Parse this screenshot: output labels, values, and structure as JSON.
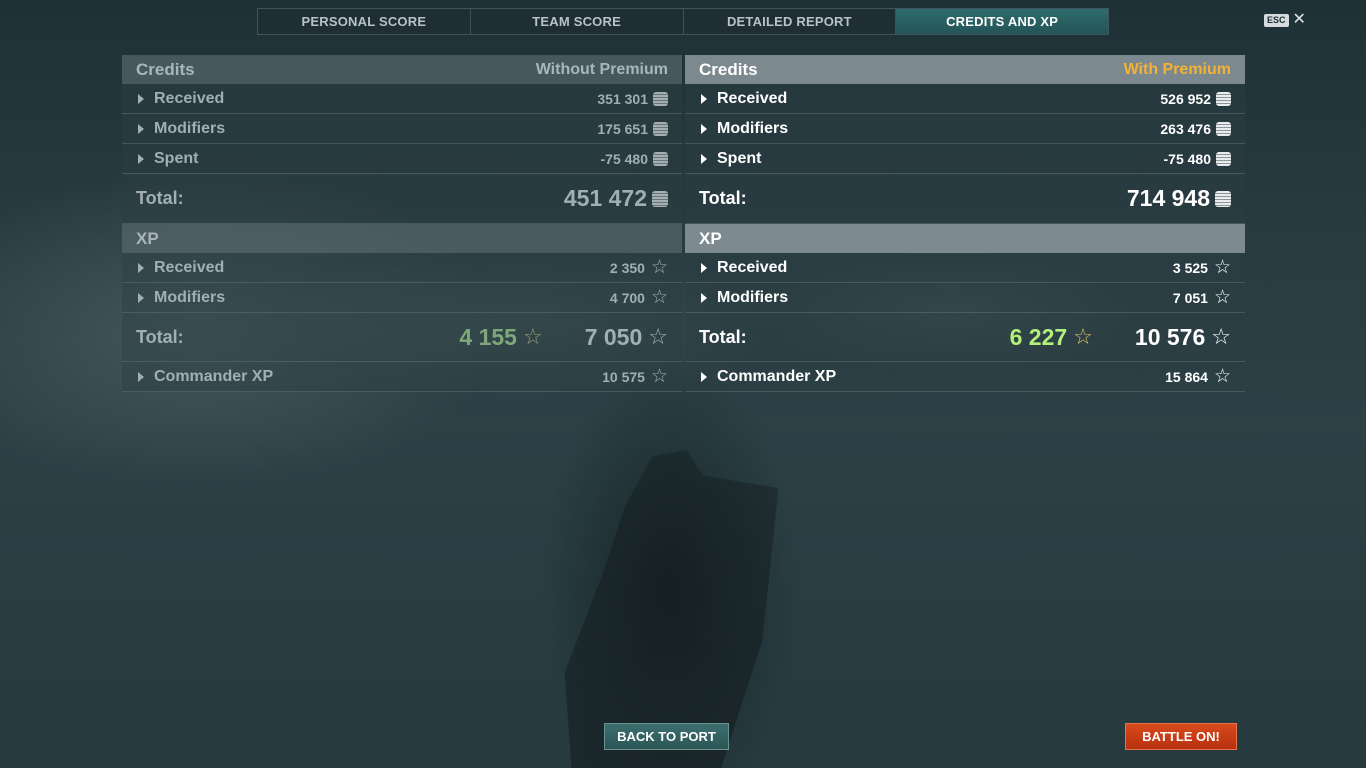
{
  "tabs": [
    {
      "label": "PERSONAL SCORE",
      "active": false
    },
    {
      "label": "TEAM SCORE",
      "active": false
    },
    {
      "label": "DETAILED REPORT",
      "active": false
    },
    {
      "label": "CREDITS AND XP",
      "active": true
    }
  ],
  "esc": {
    "key": "ESC",
    "close_icon": "close-icon"
  },
  "without_premium": {
    "credits_title": "Credits",
    "tag": "Without Premium",
    "credits_rows": [
      {
        "label": "Received",
        "value": "351 301"
      },
      {
        "label": "Modifiers",
        "value": "175 651"
      },
      {
        "label": "Spent",
        "value": "-75 480"
      }
    ],
    "credits_total_label": "Total:",
    "credits_total": "451 472",
    "xp_title": "XP",
    "xp_rows": [
      {
        "label": "Received",
        "value": "2 350"
      },
      {
        "label": "Modifiers",
        "value": "4 700"
      }
    ],
    "xp_total_label": "Total:",
    "xp_total_free": "4 155",
    "xp_total": "7 050",
    "commander_label": "Commander XP",
    "commander_value": "10 575"
  },
  "with_premium": {
    "credits_title": "Credits",
    "tag": "With Premium",
    "credits_rows": [
      {
        "label": "Received",
        "value": "526 952"
      },
      {
        "label": "Modifiers",
        "value": "263 476"
      },
      {
        "label": "Spent",
        "value": "-75 480"
      }
    ],
    "credits_total_label": "Total:",
    "credits_total": "714 948",
    "xp_title": "XP",
    "xp_rows": [
      {
        "label": "Received",
        "value": "3 525"
      },
      {
        "label": "Modifiers",
        "value": "7 051"
      }
    ],
    "xp_total_label": "Total:",
    "xp_total_free": "6 227",
    "xp_total": "10 576",
    "commander_label": "Commander XP",
    "commander_value": "15 864"
  },
  "buttons": {
    "back_to_port": "BACK TO PORT",
    "battle_on": "BATTLE ON!"
  },
  "colors": {
    "premium_tag": "#f3b233",
    "active_tab": "#2f6b6d",
    "battle_button": "#d94a1d",
    "free_xp_premium": "#b3f07a"
  },
  "icons": {
    "credits": "credits-coin-icon",
    "xp": "xp-star-icon",
    "expand": "expand-arrow-icon"
  }
}
